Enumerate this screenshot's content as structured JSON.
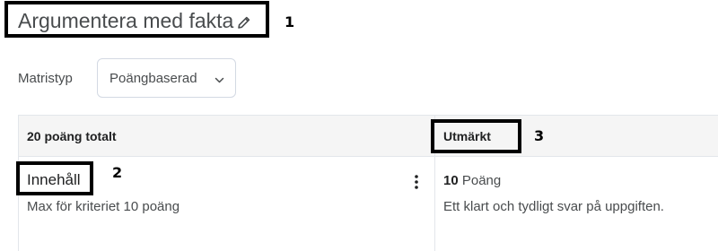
{
  "header": {
    "title": "Argumentera med fakta",
    "edit_icon": "pencil-icon"
  },
  "matrix": {
    "label": "Matristyp",
    "selected": "Poängbaserad",
    "chevron_icon": "chevron-down-icon"
  },
  "table": {
    "total_header": "20 poäng totalt",
    "level_header": "Utmärkt",
    "criterion": {
      "name": "Innehåll",
      "description": "Max för kriteriet 10 poäng",
      "menu_icon": "kebab-menu-icon"
    },
    "cell": {
      "points_value": "10",
      "points_unit": "Poäng",
      "description": "Ett klart och tydligt svar på uppgiften."
    }
  },
  "annotations": {
    "num1": "1",
    "num2": "2",
    "num3": "3"
  },
  "colors": {
    "text_primary": "#202122",
    "text_secondary": "#494c4e",
    "border": "#e3e6eb",
    "header_bg": "#f5f5f5",
    "annotation": "#000000"
  }
}
